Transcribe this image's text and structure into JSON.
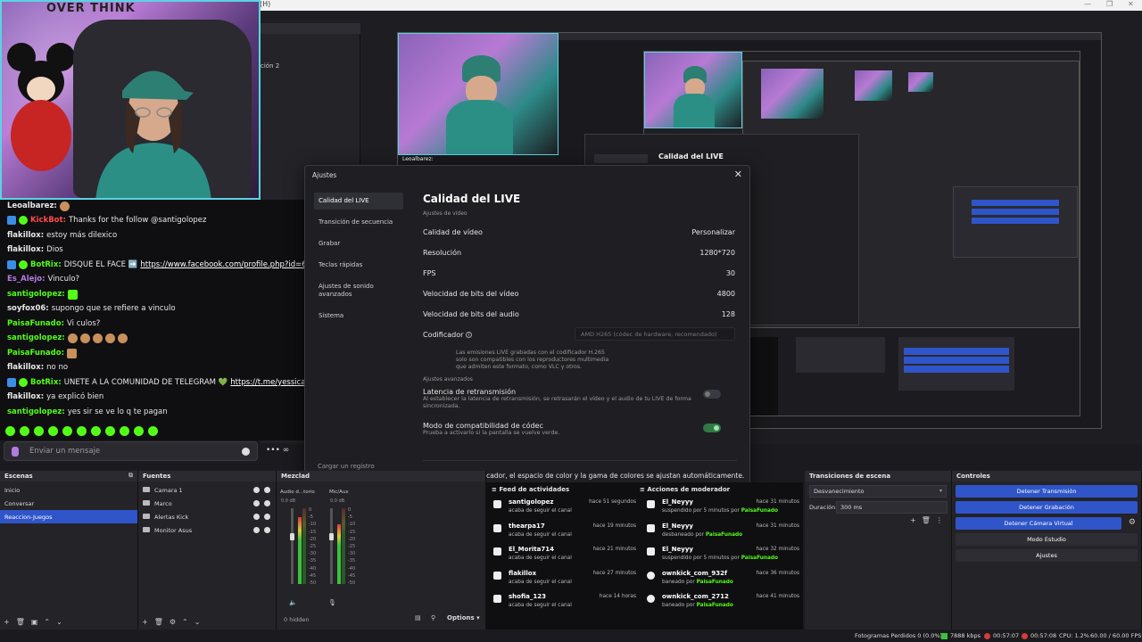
{
  "topbar": {
    "menu_h": "(H)",
    "min": "—",
    "max": "❐",
    "close": "✕"
  },
  "webcam": {
    "wall_text": "OVER THINK"
  },
  "chat": {
    "lines": [
      {
        "user": "Leoalbarez:",
        "user_color": "#e8e8e8",
        "msg": ""
      },
      {
        "user": "KickBot:",
        "user_color": "#ff4b4b",
        "msg": "Thanks for the follow @santigolopez"
      },
      {
        "user": "flakillox:",
        "user_color": "#e8e8e8",
        "msg": "estoy más dilexico"
      },
      {
        "user": "flakillox:",
        "user_color": "#e8e8e8",
        "msg": "Dios"
      },
      {
        "user": "BotRix:",
        "user_color": "#53fc18",
        "msg": "DISQUE EL FACE ➡️",
        "link": "https://www.facebook.com/profile.php?id=61584632949738"
      },
      {
        "user": "Es_Alejo:",
        "user_color": "#b47be0",
        "msg": "Vinculo?"
      },
      {
        "user": "santigolopez:",
        "user_color": "#53fc18",
        "msg": ""
      },
      {
        "user": "soyfox06:",
        "user_color": "#e8e8e8",
        "msg": "supongo que se refiere a vinculo"
      },
      {
        "user": "PaisaFunado:",
        "user_color": "#53fc18",
        "msg": "Vi culos?"
      },
      {
        "user": "santigolopez:",
        "user_color": "#53fc18",
        "msg": ""
      },
      {
        "user": "PaisaFunado:",
        "user_color": "#53fc18",
        "msg": ""
      },
      {
        "user": "flakillox:",
        "user_color": "#e8e8e8",
        "msg": "no no"
      },
      {
        "user": "BotRix:",
        "user_color": "#53fc18",
        "msg": "UNETE A LA COMUNIDAD DE TELEGRAM 💚",
        "link": "https://t.me/yessicapavas"
      },
      {
        "user": "flakillox:",
        "user_color": "#e8e8e8",
        "msg": "ya explicó bien"
      },
      {
        "user": "santigolopez:",
        "user_color": "#53fc18",
        "msg": "yes sir se ve lo q te pagan"
      }
    ],
    "input_placeholder": "Enviar un mensaje",
    "tools": "•••  ∞"
  },
  "preview": {
    "mini_titles": [
      "ción 2"
    ],
    "cam_label": "Leoalbarez:"
  },
  "settings": {
    "window_title": "Ajustes",
    "close": "✕",
    "sidebar": [
      "Calidad del LIVE",
      "Transición de secuencia",
      "Grabar",
      "Teclas rápidas",
      "Ajustes de sonido avanzados",
      "Sistema"
    ],
    "load_log": "Cargar un registro",
    "heading": "Calidad del LIVE",
    "video_section": "Ajustes de vídeo",
    "rows": [
      {
        "label": "Calidad de vídeo",
        "value": "Personalizar"
      },
      {
        "label": "Resolución",
        "value": "1280*720"
      },
      {
        "label": "FPS",
        "value": "30"
      },
      {
        "label": "Velocidad de bits del vídeo",
        "value": "4800"
      },
      {
        "label": "Velocidad de bits del audio",
        "value": "128"
      }
    ],
    "codec_label": "Codificador",
    "codec_value": "AMD H265 (códec de hardware, recomendado)",
    "codec_note": "Las emisiones LIVE grabadas con el codificador H.265 solo son compatibles con los reproductores multimedia que admiten este formato, como VLC y otros.",
    "advanced_section": "Ajustes avanzados",
    "latency_label": "Latencia de retransmisión",
    "latency_desc": "Al establecer la latencia de retransmisión, se retrasarán el vídeo y el audio de tu LIVE de forma sincronizada.",
    "compat_label": "Modo de compatibilidad de códec",
    "compat_desc": "Prueba a activarlo si la pantalla se vuelve verde.",
    "latency_on": false,
    "compat_on": true,
    "footer": "El cambio de codificador, el espacio de color y la gama de colores se ajustan automáticamente."
  },
  "scenes": {
    "title": "Escenas",
    "items": [
      "Inicio",
      "Conversar",
      "Reaccion-Juegos"
    ],
    "selected": 2
  },
  "sources": {
    "title": "Fuentes",
    "items": [
      "Camara 1",
      "Marco",
      "Alertas Kick",
      "Monitor Asus"
    ]
  },
  "mixer": {
    "title": "Mezclad",
    "ch1": "Audio d...torio",
    "ch2": "Mic/Aux",
    "db1": "0.0 dB",
    "db2": "0.0 dB",
    "scale": [
      "0",
      "-5",
      "-10",
      "-15",
      "-20",
      "-25",
      "-30",
      "-35",
      "-40",
      "-45",
      "-50",
      "-55",
      "-60"
    ],
    "hidden": "0 hidden",
    "options": "Options"
  },
  "activity": {
    "title": "Feed de actividades",
    "items": [
      {
        "name": "santigolopez",
        "sub": "acaba de seguir el canal",
        "time": "hace 51 segundos"
      },
      {
        "name": "thearpa17",
        "sub": "acaba de seguir el canal",
        "time": "hace 19 minutos"
      },
      {
        "name": "El_Morita714",
        "sub": "acaba de seguir el canal",
        "time": "hace 21 minutos"
      },
      {
        "name": "flakillox",
        "sub": "acaba de seguir el canal",
        "time": "hace 27 minutos"
      },
      {
        "name": "shofia_123",
        "sub": "acaba de seguir el canal",
        "time": "hace 14 horas"
      }
    ]
  },
  "moderation": {
    "title": "Acciones de moderador",
    "items": [
      {
        "name": "El_Neyyy",
        "sub": "suspendido por 5 minutos por",
        "by": "PaisaFunado",
        "time": "hace 31 minutos"
      },
      {
        "name": "El_Neyyy",
        "sub": "desbaneado por",
        "by": "PaisaFunado",
        "time": "hace 31 minutos"
      },
      {
        "name": "El_Neyyy",
        "sub": "suspendido por 5 minutos por",
        "by": "PaisaFunado",
        "time": "hace 32 minutos"
      },
      {
        "name": "ownkick_com_932f",
        "sub": "baneado por",
        "by": "PaisaFunado",
        "time": "hace 36 minutos"
      },
      {
        "name": "ownkick_com_2712",
        "sub": "baneado por",
        "by": "PaisaFunado",
        "time": "hace 41 minutos"
      }
    ]
  },
  "transitions": {
    "title": "Transiciones de escena",
    "type": "Desvanecimiento",
    "duration_label": "Duración",
    "duration_value": "300 ms"
  },
  "controls": {
    "title": "Controles",
    "buttons": [
      "Detener Transmisión",
      "Detener Grabación",
      "Detener Cámara Virtual",
      "Modo Estudio",
      "Ajustes"
    ]
  },
  "status": {
    "dropped": "Fotogramas Perdidos 0 (0.0%)",
    "kbps": "7888 kbps",
    "t1": "00:57:07",
    "t2": "00:57:08",
    "cpu": "CPU: 1.2%",
    "fps": "60.00 / 60.00 FPS"
  },
  "colors": {
    "accent": "#2f55c9",
    "kick_green": "#53fc18",
    "webcam_border": "#5ad3e4"
  }
}
